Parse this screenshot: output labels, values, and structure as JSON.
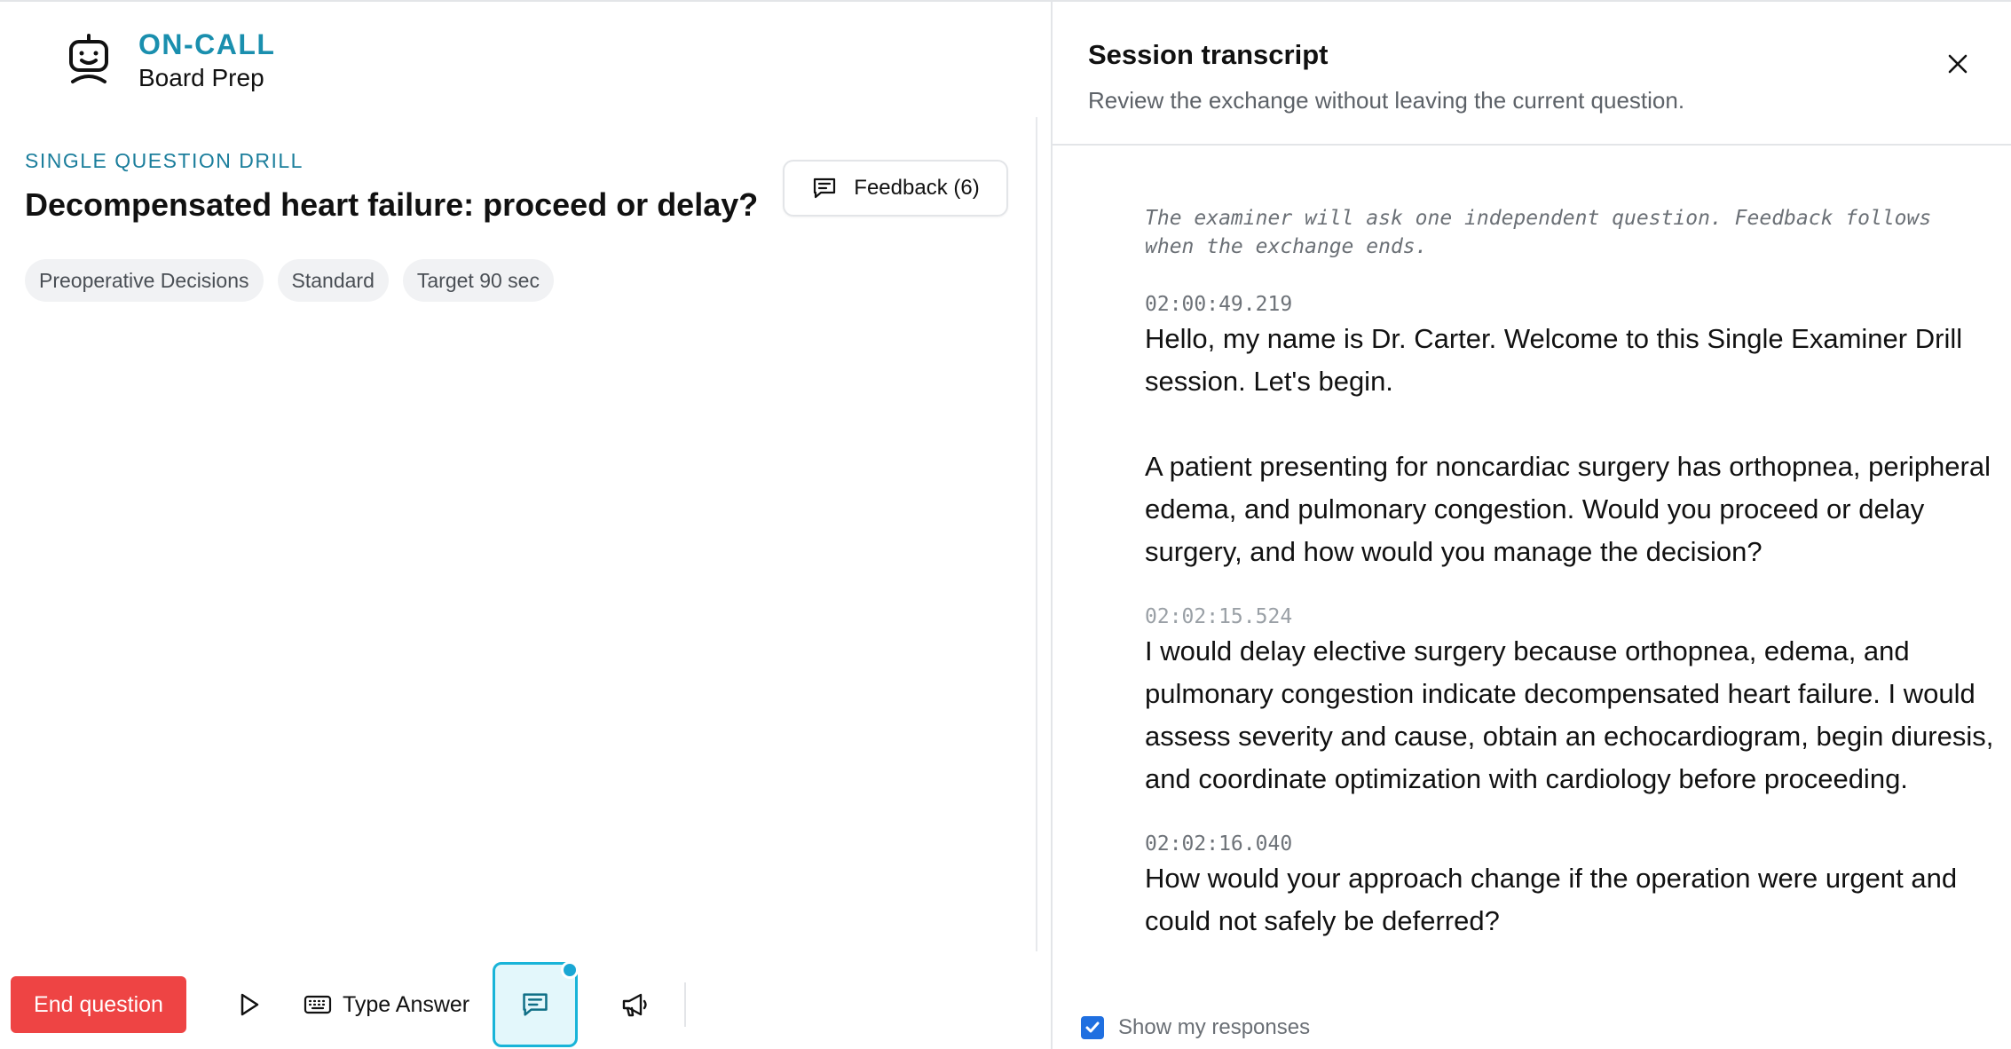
{
  "brand": {
    "name": "ON-CALL",
    "subtitle": "Board Prep"
  },
  "question": {
    "mode_label": "SINGLE QUESTION DRILL",
    "title": "Decompensated heart failure: proceed or delay?",
    "tags": [
      "Preoperative Decisions",
      "Standard",
      "Target 90 sec"
    ]
  },
  "feedback_button": {
    "label": "Feedback (6)"
  },
  "controls": {
    "end_label": "End question",
    "type_answer_label": "Type Answer"
  },
  "transcript_panel": {
    "title": "Session transcript",
    "subtitle": "Review the exchange without leaving the current question.",
    "intro": "The examiner will ask one independent question. Feedback follows when the exchange ends.",
    "entries": [
      {
        "timestamp": "02:00:49.219",
        "speaker": "examiner",
        "text": "Hello, my name is Dr. Carter. Welcome to this Single Examiner Drill session. Let's begin.\n\nA patient presenting for noncardiac surgery has orthopnea, peripheral edema, and pulmonary congestion. Would you proceed or delay surgery, and how would you manage the decision?"
      },
      {
        "timestamp": "02:02:15.524",
        "speaker": "user",
        "text": "I would delay elective surgery because orthopnea, edema, and pulmonary congestion indicate decompensated heart failure. I would assess severity and cause, obtain an echocardiogram, begin diuresis, and coordinate optimization with cardiology before proceeding."
      },
      {
        "timestamp": "02:02:16.040",
        "speaker": "examiner",
        "text": "How would your approach change if the operation were urgent and could not safely be deferred?"
      }
    ],
    "show_responses": {
      "label": "Show my responses",
      "checked": true
    }
  },
  "colors": {
    "brand": "#1a8fae",
    "danger": "#ee4444",
    "accent": "#19b4d8",
    "checkbox": "#1f6fe0"
  },
  "icons": {
    "logo": "robot-face-icon",
    "feedback": "message-lines-icon",
    "play": "play-icon",
    "keyboard": "keyboard-icon",
    "chat": "message-lines-icon",
    "announce": "megaphone-icon",
    "close": "close-icon",
    "check": "check-icon"
  }
}
